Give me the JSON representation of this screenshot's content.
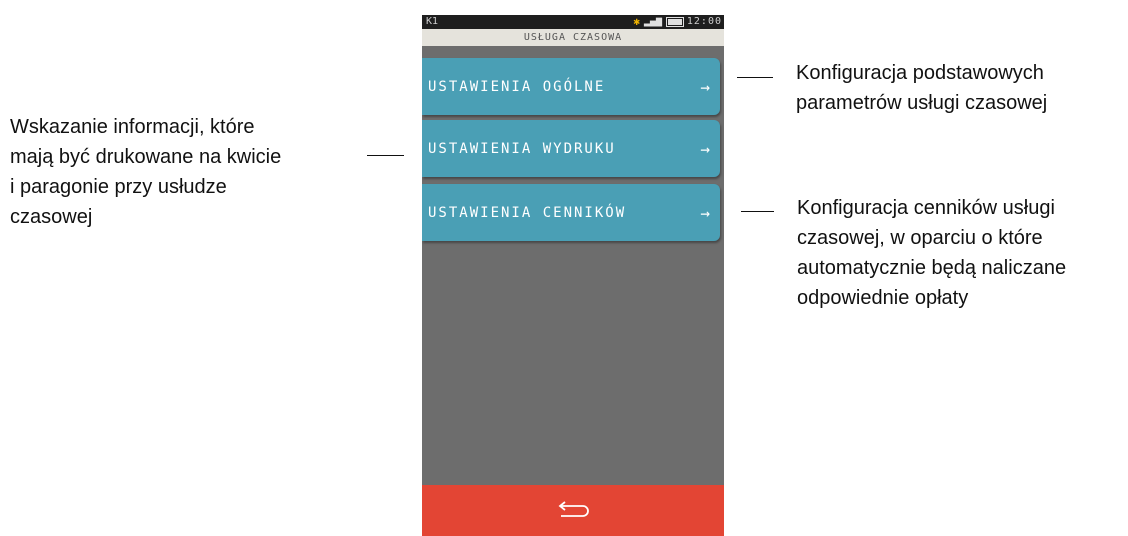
{
  "status_bar": {
    "carrier": "K1",
    "time": "12:00",
    "icons": [
      "bluetooth-icon",
      "signal-icon",
      "battery-icon"
    ]
  },
  "screen": {
    "title": "USŁUGA CZASOWA"
  },
  "menu": [
    {
      "label": "USTAWIENIA OGÓLNE",
      "arrow": "→"
    },
    {
      "label": "USTAWIENIA WYDRUKU",
      "arrow": "→"
    },
    {
      "label": "USTAWIENIA CENNIKÓW",
      "arrow": "→"
    }
  ],
  "bottom_bar": {
    "back_icon": "back-arrow-icon"
  },
  "annotations": {
    "right_top": [
      "Konfiguracja podstawowych",
      "parametrów usługi  czasowej"
    ],
    "left_middle": [
      "Wskazanie informacji, które",
      "mają być drukowane na kwicie",
      "i paragonie przy usłudze",
      "czasowej"
    ],
    "right_bottom": [
      "Konfiguracja cenników usługi",
      "czasowej, w oparciu o które",
      "automatycznie będą naliczane",
      "odpowiednie opłaty"
    ]
  },
  "colors": {
    "menu_button": "#4a9fb5",
    "bottom_bar": "#e34534",
    "screen_bg": "#6d6d6d",
    "title_bar": "#e5e3dc"
  }
}
